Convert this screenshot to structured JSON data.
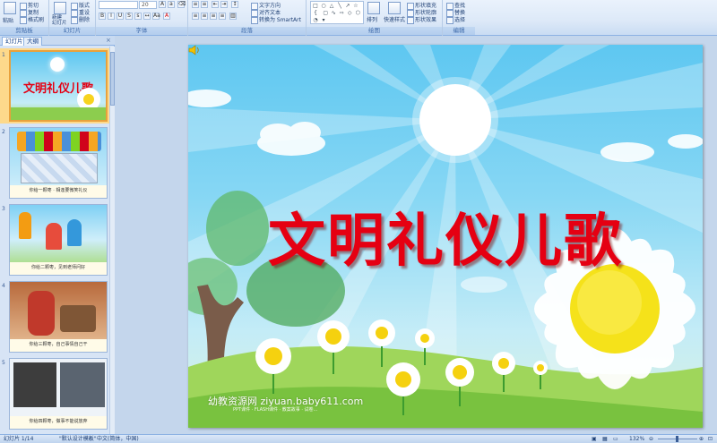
{
  "ribbon": {
    "clipboard": {
      "label": "剪贴板",
      "paste": "粘贴",
      "cut": "剪切",
      "copy": "复制",
      "format_painter": "格式刷"
    },
    "slides": {
      "label": "幻灯片",
      "new_slide": "新建\n幻灯片",
      "layout": "版式",
      "reset": "重设",
      "delete": "删除"
    },
    "font": {
      "label": "字体",
      "font_name": "",
      "font_size": "20"
    },
    "paragraph": {
      "label": "段落",
      "text_direction": "文字方向",
      "align_text": "对齐文本",
      "convert_smartart": "转换为 SmartArt"
    },
    "drawing": {
      "label": "绘图",
      "arrange": "排列",
      "quick_styles": "快速样式",
      "shape_fill": "形状填充",
      "shape_outline": "形状轮廓",
      "shape_effects": "形状效果"
    },
    "editing": {
      "label": "编辑",
      "find": "查找",
      "replace": "替换",
      "select": "选择"
    }
  },
  "panel": {
    "tab_slides": "幻灯片",
    "tab_outline": "大纲",
    "close": "×",
    "thumbnails": [
      {
        "num": "1",
        "title": "文明礼仪儿歌",
        "caption": ""
      },
      {
        "num": "2",
        "title": "",
        "caption": "你给一颗枣 · 相逢要微笑礼仪"
      },
      {
        "num": "3",
        "title": "",
        "caption": "你给二颗枣，见到老师问好"
      },
      {
        "num": "4",
        "title": "",
        "caption": "你给三颗枣，自己事情自己干"
      },
      {
        "num": "5",
        "title": "",
        "caption": "你给四颗枣，做事不能说放弃"
      }
    ]
  },
  "slide": {
    "title": "文明礼仪儿歌",
    "watermark": "幼教资源网 ziyuan.baby611.com",
    "watermark_sub": "PPT课件 · FLASH课件 · 教案故事 · 试卷..."
  },
  "status": {
    "slide_counter": "幻灯片 1/14",
    "theme": "\"默认设计模板\"",
    "language": "中文(简体，中国)",
    "zoom": "132%"
  }
}
